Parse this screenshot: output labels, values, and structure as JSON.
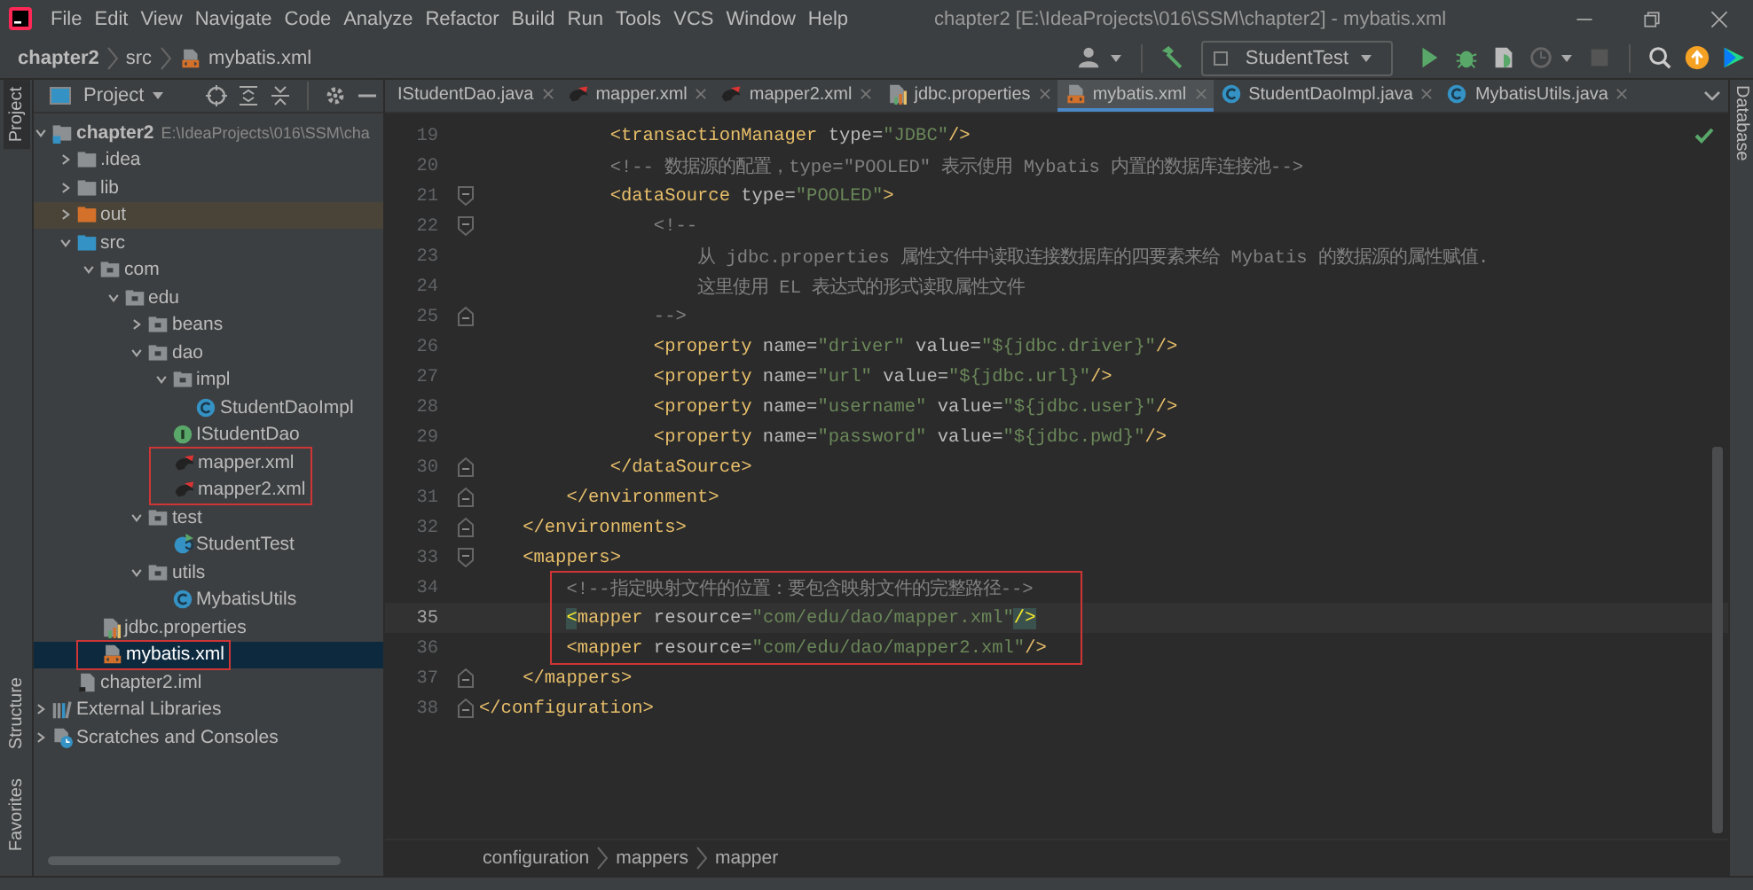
{
  "window": {
    "title": "chapter2 [E:\\IdeaProjects\\016\\SSM\\chapter2] - mybatis.xml"
  },
  "menu": [
    "File",
    "Edit",
    "View",
    "Navigate",
    "Code",
    "Analyze",
    "Refactor",
    "Build",
    "Run",
    "Tools",
    "VCS",
    "Window",
    "Help"
  ],
  "navbar": {
    "breadcrumbs": [
      "chapter2",
      "src",
      "mybatis.xml"
    ],
    "run_config": {
      "label": "StudentTest"
    }
  },
  "left_strip": [
    {
      "label": "Project",
      "selected": true,
      "kind": "top"
    },
    {
      "label": "Structure",
      "selected": false,
      "kind": "bottom"
    },
    {
      "label": "Favorites",
      "selected": false,
      "kind": "bottom"
    }
  ],
  "right_strip": [
    {
      "label": "Database",
      "selected": false
    }
  ],
  "project_panel": {
    "title": "Project",
    "tree": [
      {
        "label": "chapter2",
        "path": "E:\\IdeaProjects\\016\\SSM\\cha",
        "kind": "module",
        "expanded": true,
        "selected": false,
        "boxed": false,
        "children": [
          {
            "label": ".idea",
            "kind": "folder",
            "expanded": false,
            "selected": false,
            "boxed": false
          },
          {
            "label": "lib",
            "kind": "folder",
            "expanded": false,
            "selected": false,
            "boxed": false
          },
          {
            "label": "out",
            "kind": "excluded",
            "expanded": false,
            "selected": false,
            "boxed": false
          },
          {
            "label": "src",
            "kind": "source",
            "expanded": true,
            "selected": false,
            "boxed": false,
            "children": [
              {
                "label": "com",
                "kind": "package",
                "expanded": true,
                "selected": false,
                "boxed": false,
                "children": [
                  {
                    "label": "edu",
                    "kind": "package",
                    "expanded": true,
                    "selected": false,
                    "boxed": false,
                    "children": [
                      {
                        "label": "beans",
                        "kind": "package",
                        "expanded": false,
                        "selected": false,
                        "boxed": false
                      },
                      {
                        "label": "dao",
                        "kind": "package",
                        "expanded": true,
                        "selected": false,
                        "boxed": false,
                        "children": [
                          {
                            "label": "impl",
                            "kind": "package",
                            "expanded": true,
                            "selected": false,
                            "boxed": false,
                            "children": [
                              {
                                "label": "StudentDaoImpl",
                                "kind": "class",
                                "selected": false,
                                "boxed": false
                              }
                            ]
                          },
                          {
                            "label": "IStudentDao",
                            "kind": "interface",
                            "selected": false,
                            "boxed": false
                          },
                          {
                            "label": "mapper.xml",
                            "kind": "mybatis",
                            "selected": false,
                            "boxed": true
                          },
                          {
                            "label": "mapper2.xml",
                            "kind": "mybatis",
                            "selected": false,
                            "boxed": true
                          }
                        ]
                      },
                      {
                        "label": "test",
                        "kind": "package",
                        "expanded": true,
                        "selected": false,
                        "boxed": false,
                        "children": [
                          {
                            "label": "StudentTest",
                            "kind": "test-class",
                            "selected": false,
                            "boxed": false
                          }
                        ]
                      },
                      {
                        "label": "utils",
                        "kind": "package",
                        "expanded": true,
                        "selected": false,
                        "boxed": false,
                        "children": [
                          {
                            "label": "MybatisUtils",
                            "kind": "class",
                            "selected": false,
                            "boxed": false
                          }
                        ]
                      }
                    ]
                  }
                ]
              },
              {
                "label": "jdbc.properties",
                "kind": "properties",
                "selected": false,
                "boxed": false
              },
              {
                "label": "mybatis.xml",
                "kind": "mybatis-config",
                "selected": true,
                "boxed": true
              }
            ]
          },
          {
            "label": "chapter2.iml",
            "kind": "iml",
            "selected": false,
            "boxed": false
          }
        ]
      },
      {
        "label": "External Libraries",
        "kind": "libraries",
        "expanded": false,
        "selected": false,
        "boxed": false
      },
      {
        "label": "Scratches and Consoles",
        "kind": "scratches",
        "expanded": false,
        "selected": false,
        "boxed": false
      }
    ]
  },
  "editor": {
    "tabs": [
      {
        "label": "IStudentDao.java",
        "kind": "plain",
        "selected": false
      },
      {
        "label": "mapper.xml",
        "kind": "mybatis",
        "selected": false
      },
      {
        "label": "mapper2.xml",
        "kind": "mybatis",
        "selected": false
      },
      {
        "label": "jdbc.properties",
        "kind": "properties",
        "selected": false
      },
      {
        "label": "mybatis.xml",
        "kind": "mybatis-config",
        "selected": true
      },
      {
        "label": "StudentDaoImpl.java",
        "kind": "class",
        "selected": false
      },
      {
        "label": "MybatisUtils.java",
        "kind": "class",
        "selected": false
      }
    ],
    "lines": [
      {
        "number": "19",
        "current": false,
        "boxed": false,
        "kind": "plain",
        "tokens": [
          {
            "kind": "tag",
            "text": "            <transactionManager"
          },
          {
            "kind": "attr",
            "text": " type="
          },
          {
            "kind": "str",
            "text": "\"JDBC\""
          },
          {
            "kind": "tag",
            "text": "/>"
          }
        ]
      },
      {
        "number": "20",
        "current": false,
        "boxed": false,
        "kind": "plain",
        "tokens": [
          {
            "kind": "comment",
            "text": "            <!-- 数据源的配置，type=\"POOLED\" 表示使用 Mybatis 内置的数据库连接池-->"
          }
        ]
      },
      {
        "number": "21",
        "current": false,
        "boxed": false,
        "kind": "fold-start",
        "tokens": [
          {
            "kind": "tag",
            "text": "            <dataSource"
          },
          {
            "kind": "attr",
            "text": " type="
          },
          {
            "kind": "str",
            "text": "\"POOLED\""
          },
          {
            "kind": "tag",
            "text": ">"
          }
        ]
      },
      {
        "number": "22",
        "current": false,
        "boxed": false,
        "kind": "fold-start",
        "tokens": [
          {
            "kind": "comment",
            "text": "                <!--"
          }
        ]
      },
      {
        "number": "23",
        "current": false,
        "boxed": false,
        "kind": "plain",
        "tokens": [
          {
            "kind": "comment",
            "text": "                    从 jdbc.properties 属性文件中读取连接数据库的四要素来给 Mybatis 的数据源的属性赋值."
          }
        ]
      },
      {
        "number": "24",
        "current": false,
        "boxed": false,
        "kind": "plain",
        "tokens": [
          {
            "kind": "comment",
            "text": "                    这里使用 EL 表达式的形式读取属性文件"
          }
        ]
      },
      {
        "number": "25",
        "current": false,
        "boxed": false,
        "kind": "fold-end",
        "tokens": [
          {
            "kind": "comment",
            "text": "                -->"
          }
        ]
      },
      {
        "number": "26",
        "current": false,
        "boxed": false,
        "kind": "plain",
        "tokens": [
          {
            "kind": "tag",
            "text": "                <property"
          },
          {
            "kind": "attr",
            "text": " name="
          },
          {
            "kind": "str",
            "text": "\"driver\""
          },
          {
            "kind": "attr",
            "text": " value="
          },
          {
            "kind": "str",
            "text": "\"${jdbc.driver}\""
          },
          {
            "kind": "tag",
            "text": "/>"
          }
        ]
      },
      {
        "number": "27",
        "current": false,
        "boxed": false,
        "kind": "plain",
        "tokens": [
          {
            "kind": "tag",
            "text": "                <property"
          },
          {
            "kind": "attr",
            "text": " name="
          },
          {
            "kind": "str",
            "text": "\"url\""
          },
          {
            "kind": "attr",
            "text": " value="
          },
          {
            "kind": "str",
            "text": "\"${jdbc.url}\""
          },
          {
            "kind": "tag",
            "text": "/>"
          }
        ]
      },
      {
        "number": "28",
        "current": false,
        "boxed": false,
        "kind": "plain",
        "tokens": [
          {
            "kind": "tag",
            "text": "                <property"
          },
          {
            "kind": "attr",
            "text": " name="
          },
          {
            "kind": "str",
            "text": "\"username\""
          },
          {
            "kind": "attr",
            "text": " value="
          },
          {
            "kind": "str",
            "text": "\"${jdbc.user}\""
          },
          {
            "kind": "tag",
            "text": "/>"
          }
        ]
      },
      {
        "number": "29",
        "current": false,
        "boxed": false,
        "kind": "plain",
        "tokens": [
          {
            "kind": "tag",
            "text": "                <property"
          },
          {
            "kind": "attr",
            "text": " name="
          },
          {
            "kind": "str",
            "text": "\"password\""
          },
          {
            "kind": "attr",
            "text": " value="
          },
          {
            "kind": "str",
            "text": "\"${jdbc.pwd}\""
          },
          {
            "kind": "tag",
            "text": "/>"
          }
        ]
      },
      {
        "number": "30",
        "current": false,
        "boxed": false,
        "kind": "fold-end",
        "tokens": [
          {
            "kind": "tag",
            "text": "            </dataSource>"
          }
        ]
      },
      {
        "number": "31",
        "current": false,
        "boxed": false,
        "kind": "fold-end",
        "tokens": [
          {
            "kind": "tag",
            "text": "        </environment>"
          }
        ]
      },
      {
        "number": "32",
        "current": false,
        "boxed": false,
        "kind": "fold-end",
        "tokens": [
          {
            "kind": "tag",
            "text": "    </environments>"
          }
        ]
      },
      {
        "number": "33",
        "current": false,
        "boxed": false,
        "kind": "fold-start",
        "tokens": [
          {
            "kind": "tag",
            "text": "    <mappers>"
          }
        ]
      },
      {
        "number": "34",
        "current": false,
        "boxed": true,
        "kind": "plain",
        "tokens": [
          {
            "kind": "comment",
            "text": "        <!--指定映射文件的位置：要包含映射文件的完整路径-->"
          }
        ]
      },
      {
        "number": "35",
        "current": true,
        "boxed": true,
        "kind": "plain",
        "tokens": [
          {
            "kind": "match",
            "text": "        <"
          },
          {
            "kind": "tag",
            "text": "mapper"
          },
          {
            "kind": "attr",
            "text": " resource="
          },
          {
            "kind": "str",
            "text": "\"com/edu/dao/mapper.xml\""
          },
          {
            "kind": "match",
            "text": "/>"
          }
        ]
      },
      {
        "number": "36",
        "current": false,
        "boxed": true,
        "kind": "plain",
        "tokens": [
          {
            "kind": "tag",
            "text": "        <mapper"
          },
          {
            "kind": "attr",
            "text": " resource="
          },
          {
            "kind": "str",
            "text": "\"com/edu/dao/mapper2.xml\""
          },
          {
            "kind": "tag",
            "text": "/>"
          }
        ]
      },
      {
        "number": "37",
        "current": false,
        "boxed": false,
        "kind": "fold-end",
        "tokens": [
          {
            "kind": "tag",
            "text": "    </mappers>"
          }
        ]
      },
      {
        "number": "38",
        "current": false,
        "boxed": false,
        "kind": "fold-end",
        "tokens": [
          {
            "kind": "tag",
            "text": "</configuration>"
          }
        ]
      }
    ],
    "breadcrumbs": [
      "configuration",
      "mappers",
      "mapper"
    ]
  }
}
